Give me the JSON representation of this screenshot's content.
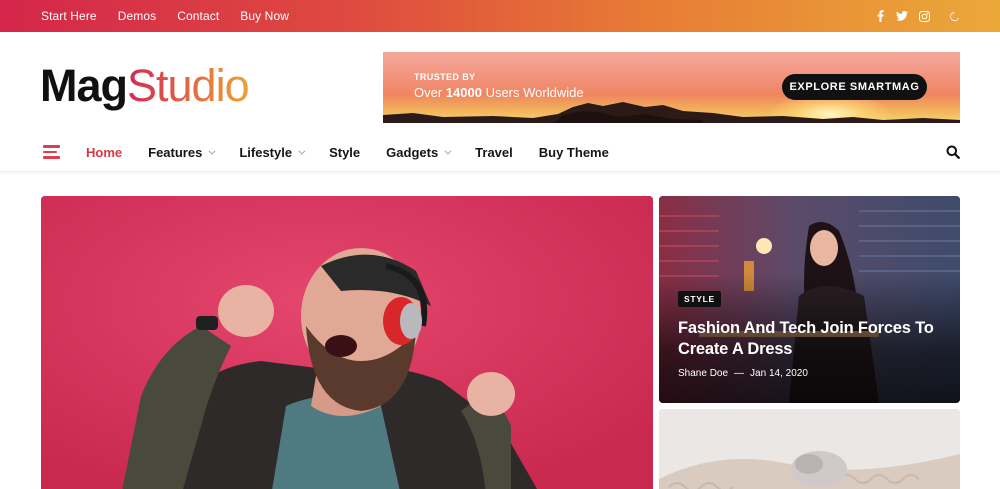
{
  "topbar": {
    "links": [
      "Start Here",
      "Demos",
      "Contact",
      "Buy Now"
    ],
    "social_icons": [
      "facebook-icon",
      "twitter-icon",
      "instagram-icon"
    ],
    "theme_toggle_icon": "moon-icon",
    "gradient": [
      "#d4264b",
      "#eba83a"
    ]
  },
  "logo": {
    "part1": "Mag",
    "part2": "Studio"
  },
  "banner": {
    "eyebrow": "TRUSTED BY",
    "text_before": "Over ",
    "count": "14000",
    "text_after": " Users Worldwide",
    "cta_label": "EXPLORE SMARTMAG"
  },
  "nav": {
    "menu_icon": "hamburger-icon",
    "items": [
      {
        "label": "Home",
        "active": true,
        "dropdown": false
      },
      {
        "label": "Features",
        "active": false,
        "dropdown": true
      },
      {
        "label": "Lifestyle",
        "active": false,
        "dropdown": true
      },
      {
        "label": "Style",
        "active": false,
        "dropdown": false
      },
      {
        "label": "Gadgets",
        "active": false,
        "dropdown": true
      },
      {
        "label": "Travel",
        "active": false,
        "dropdown": false
      },
      {
        "label": "Buy Theme",
        "active": false,
        "dropdown": false
      }
    ],
    "search_icon": "search-icon",
    "accent": "#d9363e"
  },
  "featured_side": [
    {
      "category": "STYLE",
      "title": "Fashion And Tech Join Forces To Create A Dress",
      "author": "Shane Doe",
      "separator": "—",
      "date": "Jan 14, 2020"
    }
  ]
}
